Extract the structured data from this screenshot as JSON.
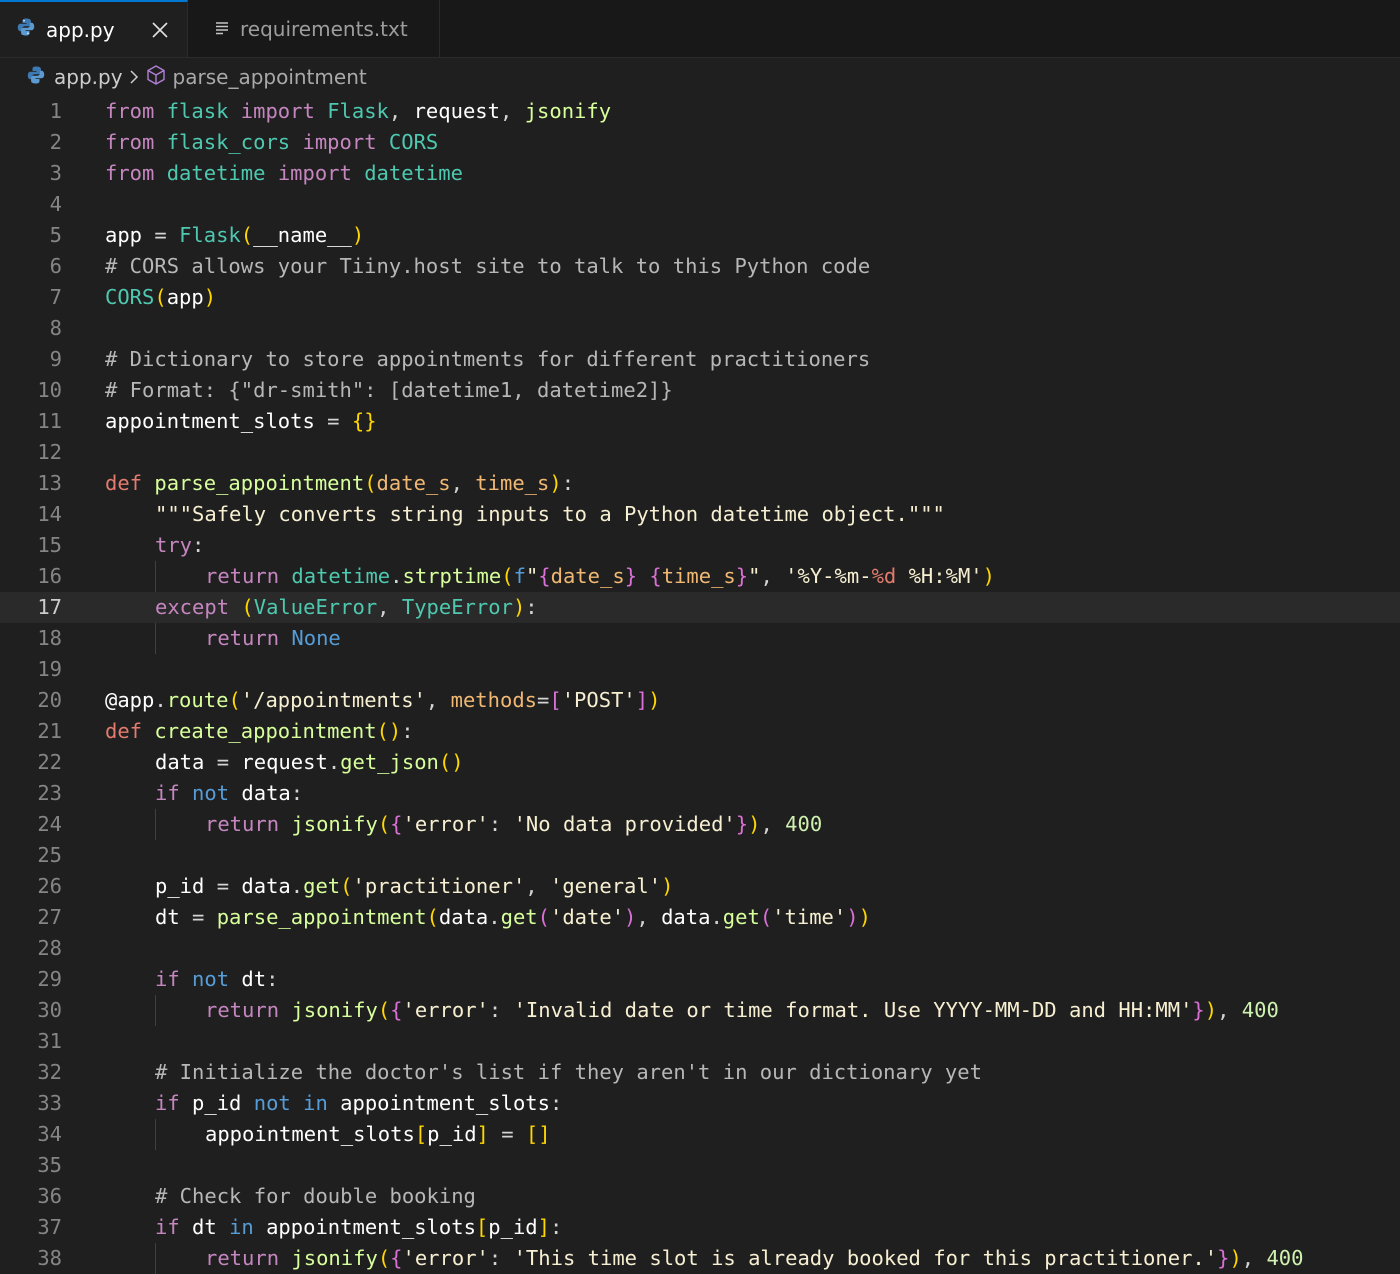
{
  "tabs": [
    {
      "label": "app.py",
      "icon": "python-icon",
      "active": true
    },
    {
      "label": "requirements.txt",
      "icon": "text-file-icon",
      "active": false
    }
  ],
  "breadcrumb": {
    "file": "app.py",
    "symbol": "parse_appointment"
  },
  "editor": {
    "current_line": 17,
    "lines": [
      {
        "n": "1",
        "indent": 0,
        "tokens": [
          [
            "from ",
            "imp"
          ],
          [
            "flask ",
            "mod"
          ],
          [
            "import ",
            "imp"
          ],
          [
            "Flask",
            "mod"
          ],
          [
            ", ",
            "op"
          ],
          [
            "request",
            "var"
          ],
          [
            ", ",
            "op"
          ],
          [
            "jsonify",
            "fn"
          ]
        ]
      },
      {
        "n": "2",
        "indent": 0,
        "tokens": [
          [
            "from ",
            "imp"
          ],
          [
            "flask_cors ",
            "mod"
          ],
          [
            "import ",
            "imp"
          ],
          [
            "CORS",
            "mod"
          ]
        ]
      },
      {
        "n": "3",
        "indent": 0,
        "tokens": [
          [
            "from ",
            "imp"
          ],
          [
            "datetime ",
            "mod"
          ],
          [
            "import ",
            "imp"
          ],
          [
            "datetime",
            "mod"
          ]
        ]
      },
      {
        "n": "4",
        "indent": 0,
        "tokens": []
      },
      {
        "n": "5",
        "indent": 0,
        "tokens": [
          [
            "app ",
            "var"
          ],
          [
            "= ",
            "op"
          ],
          [
            "Flask",
            "mod"
          ],
          [
            "(",
            "br1"
          ],
          [
            "__name__",
            "var"
          ],
          [
            ")",
            "br1"
          ]
        ]
      },
      {
        "n": "6",
        "indent": 0,
        "tokens": [
          [
            "# CORS allows your Tiiny.host site to talk to this Python code",
            "cm"
          ]
        ]
      },
      {
        "n": "7",
        "indent": 0,
        "tokens": [
          [
            "CORS",
            "mod"
          ],
          [
            "(",
            "br1"
          ],
          [
            "app",
            "var"
          ],
          [
            ")",
            "br1"
          ]
        ]
      },
      {
        "n": "8",
        "indent": 0,
        "tokens": []
      },
      {
        "n": "9",
        "indent": 0,
        "tokens": [
          [
            "# Dictionary to store appointments for different practitioners",
            "cm"
          ]
        ]
      },
      {
        "n": "10",
        "indent": 0,
        "tokens": [
          [
            "# Format: {\"dr-smith\": [datetime1, datetime2]}",
            "cm"
          ]
        ]
      },
      {
        "n": "11",
        "indent": 0,
        "tokens": [
          [
            "appointment_slots ",
            "var"
          ],
          [
            "= ",
            "op"
          ],
          [
            "{}",
            "br1"
          ]
        ]
      },
      {
        "n": "12",
        "indent": 0,
        "tokens": []
      },
      {
        "n": "13",
        "indent": 0,
        "tokens": [
          [
            "def ",
            "kw"
          ],
          [
            "parse_appointment",
            "fn"
          ],
          [
            "(",
            "br1"
          ],
          [
            "date_s",
            "param"
          ],
          [
            ", ",
            "op"
          ],
          [
            "time_s",
            "param"
          ],
          [
            ")",
            "br1"
          ],
          [
            ":",
            "op"
          ]
        ]
      },
      {
        "n": "14",
        "indent": 1,
        "tokens": [
          [
            "\"\"\"Safely converts string inputs to a Python datetime object.\"\"\"",
            "str"
          ]
        ]
      },
      {
        "n": "15",
        "indent": 1,
        "tokens": [
          [
            "try",
            "imp"
          ],
          [
            ":",
            "op"
          ]
        ]
      },
      {
        "n": "16",
        "indent": 2,
        "tokens": [
          [
            "return ",
            "imp"
          ],
          [
            "datetime",
            "mod"
          ],
          [
            ".",
            "op"
          ],
          [
            "strptime",
            "fn"
          ],
          [
            "(",
            "br1"
          ],
          [
            "f",
            "blue"
          ],
          [
            "\"",
            "str"
          ],
          [
            "{",
            "br2"
          ],
          [
            "date_s",
            "param"
          ],
          [
            "}",
            "br2"
          ],
          [
            " ",
            "str"
          ],
          [
            "{",
            "br2"
          ],
          [
            "time_s",
            "param"
          ],
          [
            "}",
            "br2"
          ],
          [
            "\"",
            "str"
          ],
          [
            ", ",
            "op"
          ],
          [
            "'%Y-%m-",
            "str"
          ],
          [
            "%d",
            "kw"
          ],
          [
            " %H:%M'",
            "str"
          ],
          [
            ")",
            "br1"
          ]
        ]
      },
      {
        "n": "17",
        "indent": 1,
        "tokens": [
          [
            "except ",
            "imp"
          ],
          [
            "(",
            "br1"
          ],
          [
            "ValueError",
            "mod"
          ],
          [
            ", ",
            "op"
          ],
          [
            "TypeError",
            "mod"
          ],
          [
            ")",
            "br1"
          ],
          [
            ":",
            "op"
          ]
        ]
      },
      {
        "n": "18",
        "indent": 2,
        "tokens": [
          [
            "return ",
            "imp"
          ],
          [
            "None",
            "blue"
          ]
        ]
      },
      {
        "n": "19",
        "indent": 0,
        "tokens": []
      },
      {
        "n": "20",
        "indent": 0,
        "tokens": [
          [
            "@app",
            "dec"
          ],
          [
            ".",
            "op"
          ],
          [
            "route",
            "fn"
          ],
          [
            "(",
            "br1"
          ],
          [
            "'/appointments'",
            "str"
          ],
          [
            ", ",
            "op"
          ],
          [
            "methods",
            "param"
          ],
          [
            "=",
            "op"
          ],
          [
            "[",
            "br2"
          ],
          [
            "'POST'",
            "str"
          ],
          [
            "]",
            "br2"
          ],
          [
            ")",
            "br1"
          ]
        ]
      },
      {
        "n": "21",
        "indent": 0,
        "tokens": [
          [
            "def ",
            "kw"
          ],
          [
            "create_appointment",
            "fn"
          ],
          [
            "()",
            "br1"
          ],
          [
            ":",
            "op"
          ]
        ]
      },
      {
        "n": "22",
        "indent": 1,
        "tokens": [
          [
            "data ",
            "var"
          ],
          [
            "= ",
            "op"
          ],
          [
            "request",
            "var"
          ],
          [
            ".",
            "op"
          ],
          [
            "get_json",
            "fn"
          ],
          [
            "()",
            "br1"
          ]
        ]
      },
      {
        "n": "23",
        "indent": 1,
        "tokens": [
          [
            "if ",
            "imp"
          ],
          [
            "not ",
            "blue"
          ],
          [
            "data",
            "var"
          ],
          [
            ":",
            "op"
          ]
        ]
      },
      {
        "n": "24",
        "indent": 2,
        "tokens": [
          [
            "return ",
            "imp"
          ],
          [
            "jsonify",
            "fn"
          ],
          [
            "(",
            "br1"
          ],
          [
            "{",
            "br2"
          ],
          [
            "'error'",
            "str"
          ],
          [
            ": ",
            "op"
          ],
          [
            "'No data provided'",
            "str"
          ],
          [
            "}",
            "br2"
          ],
          [
            ")",
            "br1"
          ],
          [
            ", ",
            "op"
          ],
          [
            "400",
            "num"
          ]
        ]
      },
      {
        "n": "25",
        "indent": 0,
        "tokens": []
      },
      {
        "n": "26",
        "indent": 1,
        "tokens": [
          [
            "p_id ",
            "var"
          ],
          [
            "= ",
            "op"
          ],
          [
            "data",
            "var"
          ],
          [
            ".",
            "op"
          ],
          [
            "get",
            "fn"
          ],
          [
            "(",
            "br1"
          ],
          [
            "'practitioner'",
            "str"
          ],
          [
            ", ",
            "op"
          ],
          [
            "'general'",
            "str"
          ],
          [
            ")",
            "br1"
          ]
        ]
      },
      {
        "n": "27",
        "indent": 1,
        "tokens": [
          [
            "dt ",
            "var"
          ],
          [
            "= ",
            "op"
          ],
          [
            "parse_appointment",
            "fn"
          ],
          [
            "(",
            "br1"
          ],
          [
            "data",
            "var"
          ],
          [
            ".",
            "op"
          ],
          [
            "get",
            "fn"
          ],
          [
            "(",
            "br2"
          ],
          [
            "'date'",
            "str"
          ],
          [
            ")",
            "br2"
          ],
          [
            ", ",
            "op"
          ],
          [
            "data",
            "var"
          ],
          [
            ".",
            "op"
          ],
          [
            "get",
            "fn"
          ],
          [
            "(",
            "br2"
          ],
          [
            "'time'",
            "str"
          ],
          [
            ")",
            "br2"
          ],
          [
            ")",
            "br1"
          ]
        ]
      },
      {
        "n": "28",
        "indent": 0,
        "tokens": []
      },
      {
        "n": "29",
        "indent": 1,
        "tokens": [
          [
            "if ",
            "imp"
          ],
          [
            "not ",
            "blue"
          ],
          [
            "dt",
            "var"
          ],
          [
            ":",
            "op"
          ]
        ]
      },
      {
        "n": "30",
        "indent": 2,
        "tokens": [
          [
            "return ",
            "imp"
          ],
          [
            "jsonify",
            "fn"
          ],
          [
            "(",
            "br1"
          ],
          [
            "{",
            "br2"
          ],
          [
            "'error'",
            "str"
          ],
          [
            ": ",
            "op"
          ],
          [
            "'Invalid date or time format. Use YYYY-MM-DD and HH:MM'",
            "str"
          ],
          [
            "}",
            "br2"
          ],
          [
            ")",
            "br1"
          ],
          [
            ", ",
            "op"
          ],
          [
            "400",
            "num"
          ]
        ]
      },
      {
        "n": "31",
        "indent": 0,
        "tokens": []
      },
      {
        "n": "32",
        "indent": 1,
        "tokens": [
          [
            "# Initialize the doctor's list if they aren't in our dictionary yet",
            "cm"
          ]
        ]
      },
      {
        "n": "33",
        "indent": 1,
        "tokens": [
          [
            "if ",
            "imp"
          ],
          [
            "p_id ",
            "var"
          ],
          [
            "not ",
            "blue"
          ],
          [
            "in ",
            "blue"
          ],
          [
            "appointment_slots",
            "var"
          ],
          [
            ":",
            "op"
          ]
        ]
      },
      {
        "n": "34",
        "indent": 2,
        "tokens": [
          [
            "appointment_slots",
            "var"
          ],
          [
            "[",
            "br1"
          ],
          [
            "p_id",
            "var"
          ],
          [
            "]",
            "br1"
          ],
          [
            " = ",
            "op"
          ],
          [
            "[]",
            "br1"
          ]
        ]
      },
      {
        "n": "35",
        "indent": 0,
        "tokens": []
      },
      {
        "n": "36",
        "indent": 1,
        "tokens": [
          [
            "# Check for double booking",
            "cm"
          ]
        ]
      },
      {
        "n": "37",
        "indent": 1,
        "tokens": [
          [
            "if ",
            "imp"
          ],
          [
            "dt ",
            "var"
          ],
          [
            "in ",
            "blue"
          ],
          [
            "appointment_slots",
            "var"
          ],
          [
            "[",
            "br1"
          ],
          [
            "p_id",
            "var"
          ],
          [
            "]",
            "br1"
          ],
          [
            ":",
            "op"
          ]
        ]
      },
      {
        "n": "38",
        "indent": 2,
        "tokens": [
          [
            "return ",
            "imp"
          ],
          [
            "jsonify",
            "fn"
          ],
          [
            "(",
            "br1"
          ],
          [
            "{",
            "br2"
          ],
          [
            "'error'",
            "str"
          ],
          [
            ": ",
            "op"
          ],
          [
            "'This time slot is already booked for this practitioner.'",
            "str"
          ],
          [
            "}",
            "br2"
          ],
          [
            ")",
            "br1"
          ],
          [
            ", ",
            "op"
          ],
          [
            "400",
            "num"
          ]
        ]
      }
    ]
  }
}
